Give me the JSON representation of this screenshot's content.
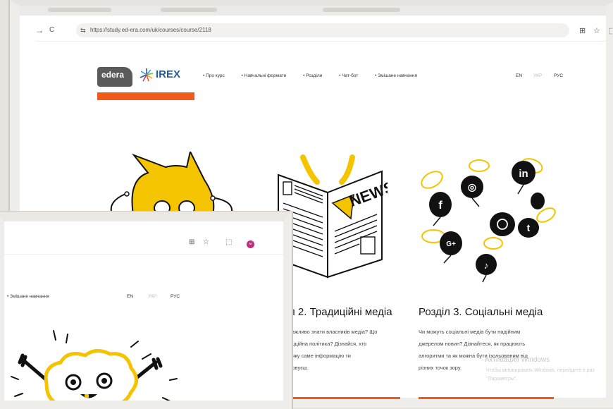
{
  "browser": {
    "url": "https://study.ed-era.com/uk/courses/course/2118",
    "back_glyph": "→",
    "reload_glyph": "C",
    "site_info_glyph": "⇆",
    "translate_glyph": "⊞",
    "star_glyph": "☆",
    "extensions_glyph": "⬚"
  },
  "header": {
    "logo_edera": "edera",
    "logo_irex": "IREX",
    "nav": [
      "Про курс",
      "Навчальні формати",
      "Розділи",
      "Чат-бот",
      "Змішане навчання"
    ],
    "languages": [
      {
        "label": "EN",
        "active": true
      },
      {
        "label": "УКР",
        "active": false
      },
      {
        "label": "РУС",
        "active": true
      }
    ]
  },
  "cards": [
    {
      "title": "л 2. Традиційні медіа",
      "description_lines": [
        "важливо знати власників медіа? Що",
        "ацційна політика? Дізнайся, хто",
        "ляку саме інформацію ти",
        "ловуєш."
      ],
      "illustration": "newspaper-news-icon",
      "news_word": "NEWS"
    },
    {
      "title": "Розділ 3. Соціальні медіа",
      "description_lines": [
        "Чи можуть соціальні медіа бути надійним",
        "джерелом новин? Дізнайтеся, як працюють",
        "алгоритми та як можна бути ізольованим від",
        "різних точок зору."
      ],
      "illustration": "social-media-bees-icon",
      "social_labels": [
        "f",
        "in",
        "G+",
        "t",
        "◎",
        "♪"
      ]
    }
  ],
  "front_window": {
    "nav_visible": "• Змішане навчання",
    "languages": [
      "EN",
      "УКР",
      "РУС"
    ],
    "avatar_letter": "м",
    "illustration": "brain-mascot-icon"
  },
  "watermark": {
    "title": "Активация Windows",
    "line1": "Чтобы активировать Windows, перейдите в раз",
    "line2": "\"Параметры\"."
  },
  "colors": {
    "accent_orange": "#f05a1a",
    "mascot_yellow": "#f5c400",
    "avatar_pink": "#c62a7e"
  }
}
